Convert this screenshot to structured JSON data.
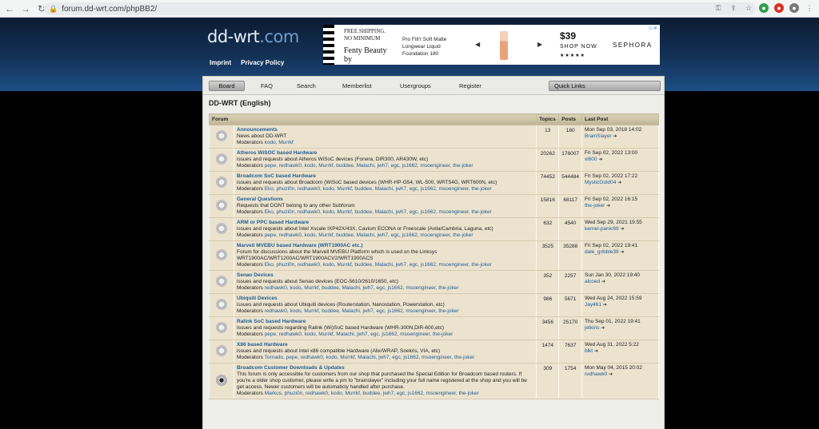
{
  "browser": {
    "url": "forum.dd-wrt.com/phpBB2/"
  },
  "header": {
    "logo_main": "dd-wrt",
    "logo_suffix": ".com",
    "links": [
      "Imprint",
      "Privacy Policy"
    ]
  },
  "ad": {
    "tagline": "FREE SHIPPING. NO MINIMUM",
    "brand": "Fenty Beauty by",
    "product": "Pro Filt'r Soft Matte Longwear Liquid Foundation 180",
    "price": "$39",
    "cta": "SHOP NOW",
    "stars": "★★★★★",
    "retailer": "SEPHORA"
  },
  "nav": {
    "board": "Board",
    "faq": "FAQ",
    "search": "Search",
    "memberlist": "Memberlist",
    "usergroups": "Usergroups",
    "register": "Register",
    "quick_links": "Quick Links"
  },
  "board_title": "DD-WRT (English)",
  "table": {
    "headers": [
      "Forum",
      "Topics",
      "Posts",
      "Last Post"
    ],
    "moderators_label": "Moderators",
    "rows": [
      {
        "name": "Announcements",
        "desc": "News about DD-WRT",
        "mods": "kodo, Murrkf",
        "topics": "13",
        "posts": "180",
        "date": "Mon Sep 03, 2018 14:02",
        "user": "BrainSlayer"
      },
      {
        "name": "Atheros WiSOC based Hardware",
        "desc": "issues and requests about Atheros WiSoC devices (Fonera, DIR300, AR430W, etc)",
        "mods": "pepe, redhawk0, kodo, Murrkf, buddee, Malachi, jwh7, egc, js1662, msoengineer, the-joker",
        "topics": "20262",
        "posts": "176007",
        "date": "Fri Sep 02, 2022 13:00",
        "user": "xl600"
      },
      {
        "name": "Broadcom SoC based Hardware",
        "desc": "issues and requests about Broadcom (WiSoC based devices (WHR-HP-G54, WL-500, WRT54G, WRT600N, etc)",
        "mods": "Eko, phuzi0n, redhawk0, kodo, Murrkf, buddee, Malachi, jwh7, egc, js1662, msoengineer, the-joker",
        "topics": "74452",
        "posts": "544484",
        "date": "Fri Sep 02, 2022 17:22",
        "user": "MysticGold04"
      },
      {
        "name": "General Questions",
        "desc": "Requests that DONT belong to any other Subforum",
        "mods": "Eko, phuzi0n, redhawk0, kodo, Murrkf, buddee, Malachi, jwh7, egc, js1662, msoengineer, the-joker",
        "topics": "15816",
        "posts": "68117",
        "date": "Fri Sep 02, 2022 16:15",
        "user": "the-joker"
      },
      {
        "name": "ARM or PPC based Hardware",
        "desc": "issues and requests about Intel Xscale IXP42X/43X, Cavium ECONA or Freescale (Avila/Cambria, Laguna, etc)",
        "mods": "pepe, redhawk0, kodo, Murrkf, buddee, Malachi, jwh7, egc, js1662, msoengineer, the-joker",
        "topics": "632",
        "posts": "4540",
        "date": "Wed Sep 29, 2021 19:55",
        "user": "kernel-panic69"
      },
      {
        "name": "Marvell MVEBU based Hardware (WRT1900AC etc.)",
        "desc": "Forum for discussions about the Marvell MVEBU Platform which is used on the Linksys WRT1900AC/WRT1200AC/WRT1900ACV2/WRT1900ACS",
        "mods": "Eko, phuzi0n, redhawk0, kodo, Murrkf, buddee, Malachi, jwh7, egc, js1662, msoengineer, the-joker",
        "topics": "3525",
        "posts": "35288",
        "date": "Fri Sep 02, 2022 19:41",
        "user": "dale_gribble39"
      },
      {
        "name": "Senao Devices",
        "desc": "issues and requests about Senao devices (EOC-5610/2610/1650, etc)",
        "mods": "redhawk0, kodo, Murrkf, buddee, Malachi, jwh7, egc, js1662, msoengineer, the-joker",
        "topics": "352",
        "posts": "2257",
        "date": "Sun Jan 30, 2022 19:40",
        "user": "alcoed"
      },
      {
        "name": "Ubiquiti Devices",
        "desc": "issues and requests about Ubiquiti devices (Routerstation, Nanostation, Powerstation, etc)",
        "mods": "redhawk0, kodo, Murrkf, buddee, Malachi, jwh7, egc, js1662, msoengineer, the-joker",
        "topics": "986",
        "posts": "5671",
        "date": "Wed Aug 24, 2022 15:59",
        "user": "Jay461"
      },
      {
        "name": "Ralink SoC based Hardware",
        "desc": "Issues and requests regarding Ralink (Wi)SoC based Hardware (WHR-300N,DIR-600,etc)",
        "mods": "pepe, redhawk0, kodo, Murrkf, Malachi, jwh7, egc, js1662, msoengineer, the-joker",
        "topics": "3456",
        "posts": "25170",
        "date": "Thu Sep 01, 2022 19:41",
        "user": "jetkins"
      },
      {
        "name": "X86 based Hardware",
        "desc": "issues and requests about Intel x86 compatible Hardware (Alix/WRAP, Soekris, VIA, etc)",
        "mods": "Tornado, pepe, redhawk0, kodo, Murrkf, Malachi, jwh7, egc, js1662, msoengineer, the-joker",
        "topics": "1474",
        "posts": "7637",
        "date": "Wed Aug 31, 2022 5:22",
        "user": "blkt"
      },
      {
        "name": "Broadcom Customer Downloads & Updates",
        "desc": "This forum is only accessible for customers from our shop that purchased the Special Edition for Broadcom based routers. If you're a older shop customer, please write a pm to \"brainslayer\" including your full name registered at the shop and you will be get access. Newer customers will be automaticly handled after purchase.",
        "mods": "Markus, phuzi0n, redhawk0, kodo, Murrkf, buddee, jwh7, egc, js1662, msoengineer, the-joker",
        "topics": "309",
        "posts": "1754",
        "date": "Mon May 04, 2015 20:02",
        "user": "redhawk0",
        "locked": true
      }
    ]
  }
}
